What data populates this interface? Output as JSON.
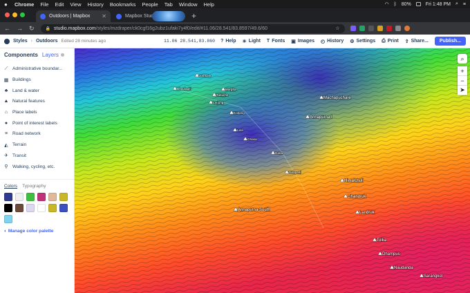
{
  "menubar": {
    "apple": "",
    "items": [
      "Chrome",
      "File",
      "Edit",
      "View",
      "History",
      "Bookmarks",
      "People",
      "Tab",
      "Window",
      "Help"
    ],
    "battery": "80%",
    "clock": "Fri 1:48 PM"
  },
  "browser": {
    "tabs": [
      {
        "title": "Outdoors | Mapbox",
        "active": true
      },
      {
        "title": "Mapbox Studio",
        "active": false
      }
    ],
    "url_host": "studio.mapbox.com",
    "url_path": "/styles/mzdraper/ck0cgf16g2ubz1ufaki7y4f0/edit/#11.06/28.541/83.8597/49.6/60"
  },
  "toolbar": {
    "styles_label": "Styles",
    "style_name": "Outdoors",
    "edited": "Edited 28 minutes ago",
    "coords": "11.06  28.541,83.860",
    "buttons": [
      "Help",
      "Light",
      "Fonts",
      "Images",
      "History",
      "Settings",
      "Print",
      "Share..."
    ],
    "publish": "Publish..."
  },
  "panel": {
    "tab_components": "Components",
    "tab_layers": "Layers",
    "components": [
      {
        "label": "Administrative boundar...",
        "icon": "boundary-icon"
      },
      {
        "label": "Buildings",
        "icon": "building-icon"
      },
      {
        "label": "Land & water",
        "icon": "land-icon"
      },
      {
        "label": "Natural features",
        "icon": "mountain-icon"
      },
      {
        "label": "Place labels",
        "icon": "place-icon"
      },
      {
        "label": "Point of interest labels",
        "icon": "poi-icon"
      },
      {
        "label": "Road network",
        "icon": "road-icon"
      },
      {
        "label": "Terrain",
        "icon": "terrain-icon"
      },
      {
        "label": "Transit",
        "icon": "transit-icon"
      },
      {
        "label": "Walking, cycling, etc.",
        "icon": "walking-icon"
      }
    ],
    "colors_tab": "Colors",
    "typography_tab": "Typography",
    "swatches": [
      "#2f3b8f",
      "#f0f0f0",
      "#3fbf3f",
      "#c0337a",
      "#e0b89a",
      "#c8b828",
      "#000000",
      "#6b4a3a",
      "#dcd8f0",
      "#ffffff",
      "#c8b828",
      "#3b4fc0",
      "#7ed4f0"
    ],
    "manage": "Manage color palette"
  },
  "map": {
    "labels": [
      "Dhaulagiri",
      "Jomsom",
      "Marpha",
      "Tukuche",
      "Larjung",
      "Kobang",
      "Lete",
      "Ghasa",
      "Dana",
      "Tatopani",
      "Annapurna I",
      "Annapurna South",
      "Machapuchare",
      "Himalchuli",
      "Ghandruk",
      "Landruk",
      "Tolka",
      "Dhampus",
      "Naudanda",
      "Sarangkot"
    ]
  }
}
